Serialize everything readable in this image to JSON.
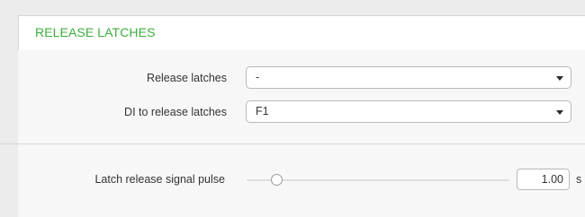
{
  "panel": {
    "title": "RELEASE LATCHES",
    "title_color": "#3cae3c"
  },
  "fields": {
    "release_latches": {
      "label": "Release latches",
      "value": "-"
    },
    "di_to_release": {
      "label": "DI to release latches",
      "value": "F1"
    }
  },
  "pulse": {
    "label": "Latch release signal pulse",
    "value": "1.00",
    "unit": "s",
    "slider_level": 0.1
  }
}
